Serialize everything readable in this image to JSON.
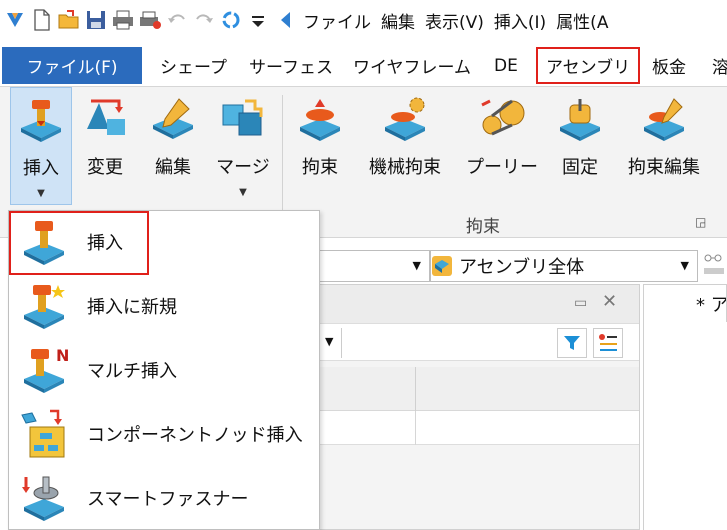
{
  "qat": {
    "icons": [
      "app-logo-icon",
      "new-icon",
      "open-icon",
      "save-icon",
      "print-icon",
      "print-setup-icon",
      "undo-icon",
      "redo-icon",
      "refresh-icon",
      "customize-icon",
      "collapse-arrow-icon"
    ],
    "menus": [
      "ファイル",
      "編集",
      "表示(V)",
      "挿入(I)",
      "属性(A"
    ]
  },
  "tabs": {
    "file": "ファイル(F)",
    "items": [
      "シェープ",
      "サーフェス",
      "ワイヤフレーム",
      "DE",
      "アセンブリ",
      "板金",
      "溶"
    ]
  },
  "ribbon": {
    "buttons": [
      {
        "label": "挿入",
        "icon": "insert-component-icon"
      },
      {
        "label": "変更",
        "icon": "replace-icon"
      },
      {
        "label": "編集",
        "icon": "edit-component-icon"
      },
      {
        "label": "マージ",
        "icon": "merge-icon"
      },
      {
        "label": "拘束",
        "icon": "constraint-icon"
      },
      {
        "label": "機械拘束",
        "icon": "mechanical-constraint-icon"
      },
      {
        "label": "プーリー",
        "icon": "pulley-icon"
      },
      {
        "label": "固定",
        "icon": "fix-icon"
      },
      {
        "label": "拘束編集",
        "icon": "edit-constraint-icon"
      }
    ],
    "group_label": "拘束"
  },
  "combo": {
    "assembly_scope": "アセンブリ全体"
  },
  "doc_tab": "* ア",
  "menu": {
    "items": [
      {
        "label": "挿入",
        "icon": "insert-icon"
      },
      {
        "label": "挿入に新規",
        "icon": "insert-new-icon"
      },
      {
        "label": "マルチ挿入",
        "icon": "multi-insert-icon"
      },
      {
        "label": "コンポーネントノッド挿入",
        "icon": "component-node-insert-icon"
      },
      {
        "label": "スマートファスナー",
        "icon": "smart-fastener-icon"
      }
    ]
  },
  "colors": {
    "file_tab": "#2b6bbd",
    "highlight_border": "#e0201a",
    "pressed_button": "#cfe3f6"
  }
}
